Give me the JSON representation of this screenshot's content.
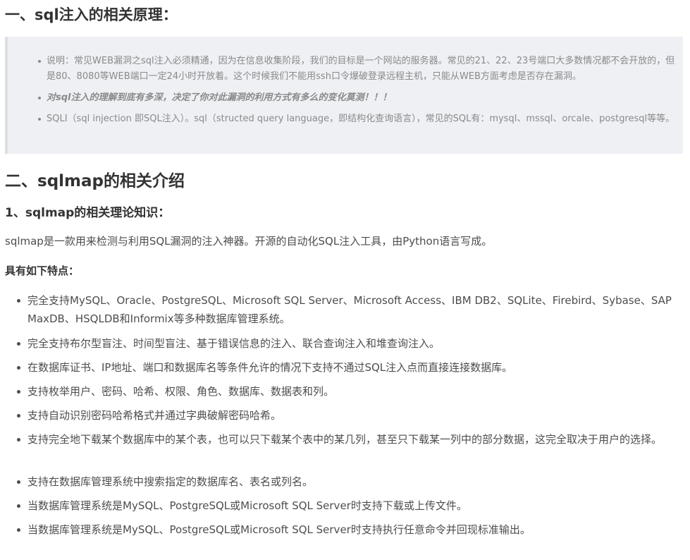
{
  "sections": {
    "principle_heading": "一、sql注入的相关原理：",
    "quote_items": [
      "说明：常见WEB漏洞之sql注入必须精通，因为在信息收集阶段，我们的目标是一个网站的服务器。常见的21、22、23号端口大多数情况都不会开放的，但是80、8080等WEB端口一定24小时开放着。这个时候我们不能用ssh口令爆破登录远程主机，只能从WEB方面考虑是否存在漏洞。",
      "对sql注入的理解到底有多深，决定了你对此漏洞的利用方式有多么的变化莫测！！！",
      "SQLI（sql injection 即SQL注入）。sql（structed query language，即结构化查询语言），常见的SQL有：mysql、mssql、orcale、postgresql等等。"
    ],
    "intro_heading": "二、sqlmap的相关介绍",
    "theory_heading": "1、sqlmap的相关理论知识：",
    "sqlmap_paragraph": "sqlmap是一款用来检测与利用SQL漏洞的注入神器。开源的自动化SQL注入工具，由Python语言写成。",
    "features_label": "具有如下特点：",
    "features": [
      "完全支持MySQL、Oracle、PostgreSQL、Microsoft SQL Server、Microsoft Access、IBM DB2、SQLite、Firebird、Sybase、SAP MaxDB、HSQLDB和Informix等多种数据库管理系统。",
      "完全支持布尔型盲注、时间型盲注、基于错误信息的注入、联合查询注入和堆查询注入。",
      "在数据库证书、IP地址、端口和数据库名等条件允许的情况下支持不通过SQL注入点而直接连接数据库。",
      "支持枚举用户、密码、哈希、权限、角色、数据库、数据表和列。",
      "支持自动识别密码哈希格式并通过字典破解密码哈希。",
      "支持完全地下载某个数据库中的某个表，也可以只下载某个表中的某几列，甚至只下载某一列中的部分数据，这完全取决于用户的选择。",
      "支持在数据库管理系统中搜索指定的数据库名、表名或列名。",
      "当数据库管理系统是MySQL、PostgreSQL或Microsoft SQL Server时支持下载或上传文件。",
      "当数据库管理系统是MySQL、PostgreSQL或Microsoft SQL Server时支持执行任意命令并回现标准输出。"
    ]
  }
}
